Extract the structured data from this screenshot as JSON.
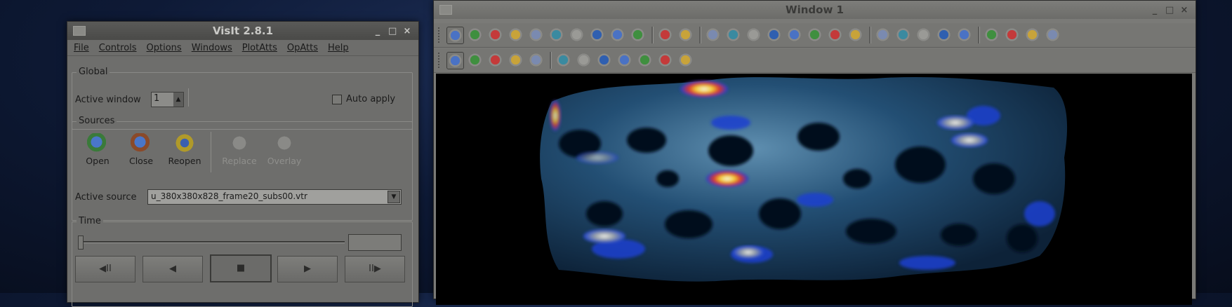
{
  "visit_window": {
    "title": "VisIt 2.8.1",
    "menu": [
      "File",
      "Controls",
      "Options",
      "Windows",
      "PlotAtts",
      "OpAtts",
      "Help"
    ],
    "global": {
      "title": "Global",
      "active_window_label": "Active window",
      "active_window_value": "1",
      "auto_apply_label": "Auto apply"
    },
    "sources": {
      "title": "Sources",
      "buttons": [
        "Open",
        "Close",
        "Reopen",
        "Replace",
        "Overlay"
      ],
      "active_source_label": "Active source",
      "active_source_value": "u_380x380x828_frame20_subs00.vtr"
    },
    "time": {
      "title": "Time",
      "slider_fraction": 0,
      "vcr_buttons": [
        "◀II",
        "◀",
        "■",
        "▶",
        "II▶"
      ]
    },
    "window_controls": [
      "_",
      "□",
      "×"
    ]
  },
  "render_window": {
    "title": "Window 1",
    "window_controls": [
      "_",
      "□",
      "×"
    ],
    "toolbar_icons": [
      "active-window-icon",
      "new-window-icon",
      "clone-window-icon",
      "delete-window-icon",
      "layout-1x1-icon",
      "layout-1x2-icon",
      "layout-2x1-icon",
      "layout-2x2-icon",
      "layout-3x1-icon",
      "layout-3x3-icon",
      "lock-view-icon",
      "lock-time-icon",
      "clear-window-icon",
      "draw-plots-icon",
      "draw-plots-all-icon",
      "draw-plots-stacked-icon",
      "plot-group-icon",
      "plot-group-2-icon",
      "plot-group-3-icon",
      "refresh-icon",
      "step-back-icon",
      "play-back-icon",
      "stop-icon",
      "play-icon",
      "step-forward-icon",
      "save-image-icon",
      "pick-icon",
      "lineout-icon",
      "query-icon"
    ],
    "mode_icons": [
      "navigate-icon",
      "zoom-icon",
      "lineout-tool-icon",
      "pick-tool-icon",
      "pick-node-icon",
      "axes-icon",
      "point-tool-icon",
      "line-tool-icon",
      "plane-tool-icon",
      "box-tool-icon",
      "sphere-tool-icon",
      "extents-tool-icon"
    ]
  }
}
